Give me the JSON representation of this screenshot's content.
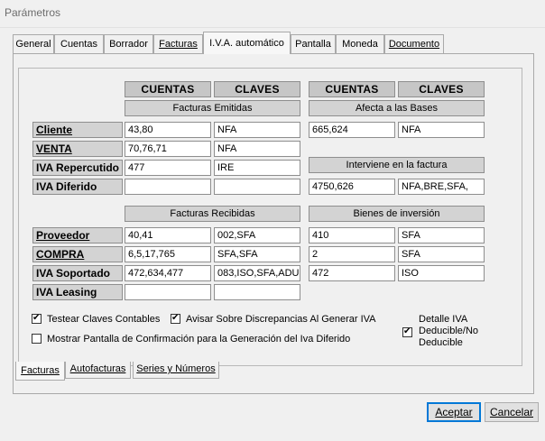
{
  "window": {
    "title": "Parámetros"
  },
  "tabs": [
    {
      "label": "General"
    },
    {
      "label": "Cuentas"
    },
    {
      "label": "Borrador"
    },
    {
      "label": "Facturas"
    },
    {
      "label": "I.V.A. automático"
    },
    {
      "label": "Pantalla"
    },
    {
      "label": "Moneda"
    },
    {
      "label": "Documento"
    }
  ],
  "active_tab": "I.V.A. automático",
  "headers": {
    "cuentas": "CUENTAS",
    "claves": "CLAVES",
    "cuentas2": "CUENTAS",
    "claves2": "CLAVES"
  },
  "emitidas": {
    "title": "Facturas Emitidas",
    "rows": [
      {
        "label": "Cliente",
        "cuentas": "43,80",
        "claves": "NFA"
      },
      {
        "label": "VENTA",
        "cuentas": "70,76,71",
        "claves": "NFA"
      },
      {
        "label": "IVA Repercutido",
        "cuentas": "477",
        "claves": "IRE"
      },
      {
        "label": "IVA Diferido",
        "cuentas": "",
        "claves": ""
      }
    ]
  },
  "afecta": {
    "title": "Afecta a las Bases",
    "cuentas": "665,624",
    "claves": "NFA"
  },
  "interviene": {
    "title": "Interviene en la factura",
    "cuentas": "4750,626",
    "claves": "NFA,BRE,SFA,"
  },
  "recibidas": {
    "title": "Facturas Recibidas",
    "rows": [
      {
        "label": "Proveedor",
        "cuentas": "40,41",
        "claves": "002,SFA"
      },
      {
        "label": "COMPRA",
        "cuentas": "6,5,17,765",
        "claves": "SFA,SFA"
      },
      {
        "label": "IVA Soportado",
        "cuentas": "472,634,477",
        "claves": "083,ISO,SFA,ADU"
      },
      {
        "label": "IVA Leasing",
        "cuentas": "",
        "claves": ""
      }
    ]
  },
  "bienes": {
    "title": "Bienes de inversión",
    "rows": [
      {
        "cuentas": "410",
        "claves": "SFA"
      },
      {
        "cuentas": "2",
        "claves": "SFA"
      },
      {
        "cuentas": "472",
        "claves": "ISO"
      }
    ]
  },
  "checkboxes": {
    "testear": {
      "label": "Testear Claves Contables",
      "checked": true
    },
    "avisar": {
      "label": "Avisar Sobre Discrepancias Al Generar IVA",
      "checked": true
    },
    "mostrar": {
      "label": "Mostrar Pantalla de Confirmación para la Generación del Iva Diferido",
      "checked": false
    },
    "detalle": {
      "line1": "Detalle IVA",
      "line2": "Deducible/No",
      "line3": "Deducible",
      "checked": true
    }
  },
  "bottom_tabs": [
    {
      "label": "Facturas"
    },
    {
      "label": "Autofacturas"
    },
    {
      "label": "Series y Números"
    }
  ],
  "active_bottom_tab": "Facturas",
  "buttons": {
    "accept": "Aceptar",
    "cancel": "Cancelar"
  }
}
